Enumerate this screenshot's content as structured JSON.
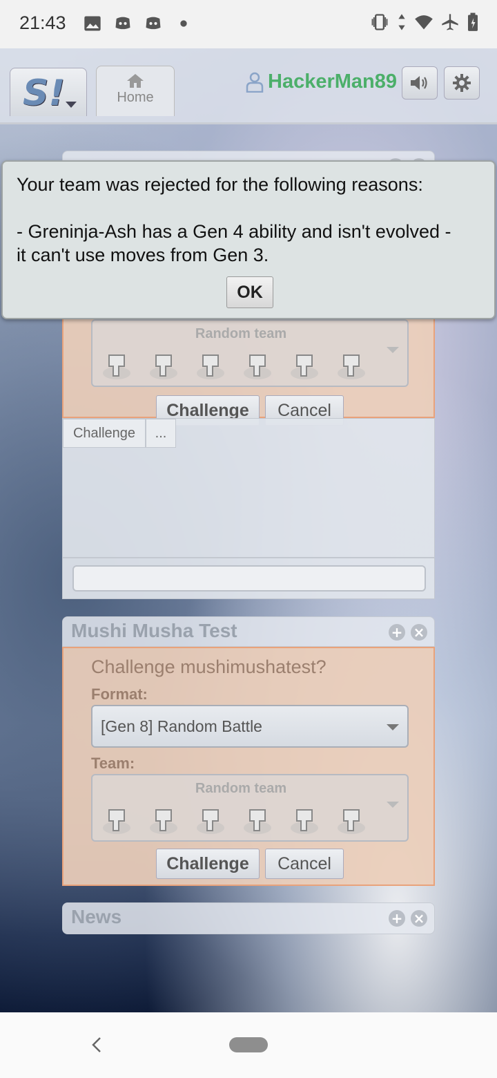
{
  "status_bar": {
    "time": "21:43",
    "left_icons": [
      "image-icon",
      "discord-icon",
      "discord-icon",
      "dot-icon"
    ],
    "right_icons": [
      "vibrate-icon",
      "data-arrows-icon",
      "wifi-icon",
      "airplane-icon",
      "battery-icon"
    ]
  },
  "header": {
    "logo": "S!",
    "home_tab_label": "Home",
    "username": "HackerMan89"
  },
  "colors": {
    "username": "#4caf6a",
    "challenge_bg": "#ecceba",
    "challenge_border": "#e9a27a"
  },
  "top_panel": {
    "team_label": "Random team",
    "challenge_label": "Challenge",
    "cancel_label": "Cancel",
    "chat_tabs": [
      "Challenge",
      "..."
    ]
  },
  "mushi_panel": {
    "title": "Mushi Musha Test",
    "heading": "Challenge mushimushatest?",
    "format_label": "Format:",
    "format_value": "[Gen 8] Random Battle",
    "team_label": "Team:",
    "team_value": "Random team",
    "challenge_label": "Challenge",
    "cancel_label": "Cancel"
  },
  "news_panel": {
    "title": "News"
  },
  "modal": {
    "line1": "Your team was rejected for the following reasons:",
    "line2": "- Greninja-Ash has a Gen 4 ability and isn't evolved -",
    "line3": "it can't use moves from Gen 3.",
    "ok_label": "OK"
  }
}
